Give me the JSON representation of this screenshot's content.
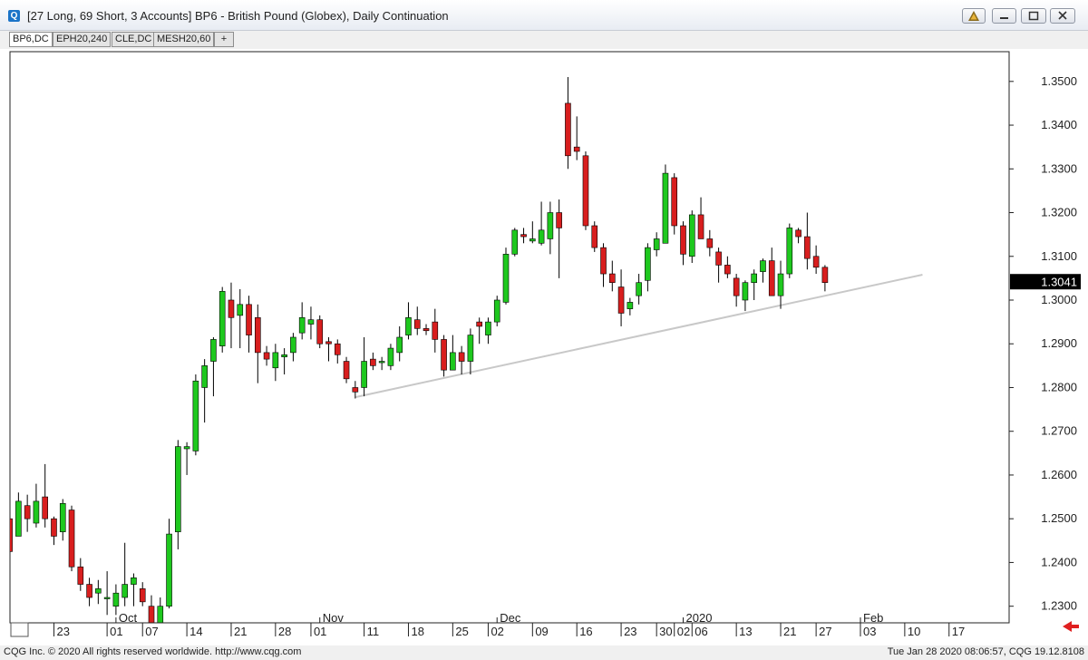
{
  "window": {
    "title": "[27 Long, 69 Short, 3 Accounts]  BP6 - British Pound (Globex), Daily Continuation",
    "app_icon_glyph": "Q"
  },
  "tabs": [
    {
      "label": "BP6,DC",
      "active": true
    },
    {
      "label": "EPH20,240",
      "active": false
    },
    {
      "label": "CLE,DC",
      "active": false
    },
    {
      "label": "MESH20,60",
      "active": false
    },
    {
      "label": "+",
      "active": false
    }
  ],
  "status": {
    "left": "CQG Inc. © 2020 All rights reserved worldwide. http://www.cqg.com",
    "right": "Tue Jan 28 2020 08:06:57, CQG 19.12.8108"
  },
  "colors": {
    "up": "#1ec81e",
    "down": "#d81e1e",
    "trendline": "#c8c8c8",
    "accent_arrow": "#e02020"
  },
  "chart_data": {
    "type": "candlestick",
    "title": "",
    "ylim": [
      1.2262,
      1.3568
    ],
    "y_ticks": [
      1.23,
      1.24,
      1.25,
      1.26,
      1.27,
      1.28,
      1.29,
      1.3,
      1.31,
      1.32,
      1.33,
      1.34,
      1.35
    ],
    "y_tick_labels": [
      "1.2300",
      "1.2400",
      "1.2500",
      "1.2600",
      "1.2700",
      "1.2800",
      "1.2900",
      "1.3000",
      "1.3100",
      "1.3200",
      "1.3300",
      "1.3400",
      "1.3500"
    ],
    "last_price": 1.3041,
    "last_price_label": "1.3041",
    "month_labels": [
      {
        "label": "Oct",
        "x": 12
      },
      {
        "label": "Nov",
        "x": 35
      },
      {
        "label": "Dec",
        "x": 55
      },
      {
        "label": "2020",
        "x": 76
      },
      {
        "label": "Feb",
        "x": 96
      }
    ],
    "x_ticks": [
      {
        "label": "23",
        "x": 5
      },
      {
        "label": "01",
        "x": 11
      },
      {
        "label": "07",
        "x": 15
      },
      {
        "label": "14",
        "x": 20
      },
      {
        "label": "21",
        "x": 25
      },
      {
        "label": "28",
        "x": 30
      },
      {
        "label": "01",
        "x": 34
      },
      {
        "label": "11",
        "x": 40
      },
      {
        "label": "18",
        "x": 45
      },
      {
        "label": "25",
        "x": 50
      },
      {
        "label": "02",
        "x": 54
      },
      {
        "label": "09",
        "x": 59
      },
      {
        "label": "16",
        "x": 64
      },
      {
        "label": "23",
        "x": 69
      },
      {
        "label": "30",
        "x": 73
      },
      {
        "label": "02",
        "x": 75
      },
      {
        "label": "06",
        "x": 77
      },
      {
        "label": "13",
        "x": 82
      },
      {
        "label": "21",
        "x": 87
      },
      {
        "label": "27",
        "x": 91
      },
      {
        "label": "03",
        "x": 96
      },
      {
        "label": "10",
        "x": 101
      },
      {
        "label": "17",
        "x": 106
      }
    ],
    "trendline": [
      [
        39,
        1.2778
      ],
      [
        103,
        1.3058
      ]
    ],
    "candles": [
      [
        0,
        1.25,
        1.2515,
        1.2425,
        1.2425
      ],
      [
        1,
        1.246,
        1.256,
        1.246,
        1.254
      ],
      [
        2,
        1.253,
        1.2555,
        1.247,
        1.25
      ],
      [
        3,
        1.249,
        1.258,
        1.248,
        1.254
      ],
      [
        4,
        1.255,
        1.2625,
        1.248,
        1.25
      ],
      [
        5,
        1.25,
        1.2505,
        1.244,
        1.246
      ],
      [
        6,
        1.247,
        1.2545,
        1.245,
        1.2535
      ],
      [
        7,
        1.252,
        1.253,
        1.238,
        1.239
      ],
      [
        8,
        1.239,
        1.241,
        1.2335,
        1.235
      ],
      [
        9,
        1.235,
        1.2365,
        1.23,
        1.232
      ],
      [
        10,
        1.233,
        1.236,
        1.2305,
        1.234
      ],
      [
        11,
        1.232,
        1.238,
        1.228,
        1.232
      ],
      [
        12,
        1.23,
        1.235,
        1.228,
        1.233
      ],
      [
        13,
        1.232,
        1.2445,
        1.23,
        1.235
      ],
      [
        14,
        1.235,
        1.2375,
        1.23,
        1.2365
      ],
      [
        15,
        1.234,
        1.2355,
        1.23,
        1.231
      ],
      [
        16,
        1.23,
        1.2325,
        1.223,
        1.224
      ],
      [
        17,
        1.224,
        1.232,
        1.222,
        1.23
      ],
      [
        18,
        1.23,
        1.25,
        1.2295,
        1.2465
      ],
      [
        19,
        1.247,
        1.268,
        1.243,
        1.2665
      ],
      [
        20,
        1.266,
        1.2675,
        1.26,
        1.2665
      ],
      [
        21,
        1.2655,
        1.283,
        1.2645,
        1.2815
      ],
      [
        22,
        1.28,
        1.2865,
        1.272,
        1.285
      ],
      [
        23,
        1.286,
        1.2915,
        1.278,
        1.291
      ],
      [
        24,
        1.2895,
        1.303,
        1.288,
        1.302
      ],
      [
        25,
        1.3,
        1.304,
        1.289,
        1.296
      ],
      [
        26,
        1.2965,
        1.3025,
        1.289,
        1.299
      ],
      [
        27,
        1.299,
        1.301,
        1.288,
        1.292
      ],
      [
        28,
        1.296,
        1.299,
        1.281,
        1.288
      ],
      [
        29,
        1.288,
        1.2895,
        1.285,
        1.2865
      ],
      [
        30,
        1.2845,
        1.29,
        1.2815,
        1.288
      ],
      [
        31,
        1.287,
        1.289,
        1.283,
        1.2875
      ],
      [
        32,
        1.288,
        1.2925,
        1.286,
        1.2915
      ],
      [
        33,
        1.2925,
        1.2995,
        1.291,
        1.296
      ],
      [
        34,
        1.2945,
        1.2985,
        1.291,
        1.2955
      ],
      [
        35,
        1.2955,
        1.2965,
        1.289,
        1.29
      ],
      [
        36,
        1.2905,
        1.2915,
        1.286,
        1.29
      ],
      [
        37,
        1.29,
        1.291,
        1.2855,
        1.2875
      ],
      [
        38,
        1.286,
        1.287,
        1.281,
        1.282
      ],
      [
        39,
        1.28,
        1.2815,
        1.2775,
        1.279
      ],
      [
        40,
        1.28,
        1.2915,
        1.278,
        1.286
      ],
      [
        41,
        1.2865,
        1.288,
        1.284,
        1.285
      ],
      [
        42,
        1.286,
        1.287,
        1.284,
        1.286
      ],
      [
        43,
        1.285,
        1.29,
        1.284,
        1.289
      ],
      [
        44,
        1.288,
        1.294,
        1.286,
        1.2915
      ],
      [
        45,
        1.292,
        1.2995,
        1.291,
        1.296
      ],
      [
        46,
        1.2955,
        1.2985,
        1.292,
        1.2935
      ],
      [
        47,
        1.2935,
        1.2945,
        1.292,
        1.293
      ],
      [
        48,
        1.295,
        1.298,
        1.288,
        1.291
      ],
      [
        49,
        1.291,
        1.292,
        1.2825,
        1.284
      ],
      [
        50,
        1.284,
        1.292,
        1.284,
        1.288
      ],
      [
        51,
        1.288,
        1.2895,
        1.283,
        1.286
      ],
      [
        52,
        1.286,
        1.2935,
        1.283,
        1.292
      ],
      [
        53,
        1.295,
        1.296,
        1.29,
        1.294
      ],
      [
        54,
        1.292,
        1.296,
        1.29,
        1.295
      ],
      [
        55,
        1.295,
        1.301,
        1.294,
        1.3
      ],
      [
        56,
        1.2995,
        1.312,
        1.299,
        1.3105
      ],
      [
        57,
        1.3105,
        1.3165,
        1.31,
        1.316
      ],
      [
        58,
        1.315,
        1.3165,
        1.313,
        1.3145
      ],
      [
        59,
        1.3135,
        1.318,
        1.313,
        1.314
      ],
      [
        60,
        1.313,
        1.3225,
        1.3125,
        1.316
      ],
      [
        61,
        1.314,
        1.3225,
        1.3105,
        1.32
      ],
      [
        62,
        1.32,
        1.323,
        1.305,
        1.3165
      ],
      [
        63,
        1.345,
        1.351,
        1.33,
        1.333
      ],
      [
        64,
        1.335,
        1.342,
        1.332,
        1.334
      ],
      [
        65,
        1.333,
        1.334,
        1.316,
        1.317
      ],
      [
        66,
        1.317,
        1.318,
        1.311,
        1.312
      ],
      [
        67,
        1.312,
        1.313,
        1.303,
        1.306
      ],
      [
        68,
        1.306,
        1.309,
        1.302,
        1.304
      ],
      [
        69,
        1.303,
        1.307,
        1.294,
        1.297
      ],
      [
        70,
        1.298,
        1.3005,
        1.2965,
        1.2995
      ],
      [
        71,
        1.301,
        1.306,
        1.299,
        1.304
      ],
      [
        72,
        1.3045,
        1.313,
        1.302,
        1.312
      ],
      [
        73,
        1.3115,
        1.3155,
        1.31,
        1.314
      ],
      [
        74,
        1.313,
        1.331,
        1.313,
        1.329
      ],
      [
        75,
        1.328,
        1.329,
        1.315,
        1.317
      ],
      [
        76,
        1.317,
        1.318,
        1.308,
        1.3105
      ],
      [
        77,
        1.31,
        1.3205,
        1.3085,
        1.3195
      ],
      [
        78,
        1.3195,
        1.3235,
        1.314,
        1.314
      ],
      [
        79,
        1.314,
        1.316,
        1.31,
        1.312
      ],
      [
        80,
        1.311,
        1.312,
        1.304,
        1.308
      ],
      [
        81,
        1.308,
        1.31,
        1.305,
        1.306
      ],
      [
        82,
        1.305,
        1.306,
        1.2985,
        1.301
      ],
      [
        83,
        1.3,
        1.3045,
        1.2975,
        1.304
      ],
      [
        84,
        1.304,
        1.307,
        1.3,
        1.306
      ],
      [
        85,
        1.3065,
        1.3095,
        1.304,
        1.309
      ],
      [
        86,
        1.309,
        1.312,
        1.301,
        1.301
      ],
      [
        87,
        1.301,
        1.309,
        1.298,
        1.306
      ],
      [
        88,
        1.306,
        1.3175,
        1.305,
        1.3165
      ],
      [
        89,
        1.316,
        1.3165,
        1.313,
        1.3145
      ],
      [
        90,
        1.3145,
        1.32,
        1.307,
        1.3095
      ],
      [
        91,
        1.31,
        1.3125,
        1.306,
        1.3075
      ],
      [
        92,
        1.3075,
        1.308,
        1.302,
        1.304
      ]
    ]
  }
}
